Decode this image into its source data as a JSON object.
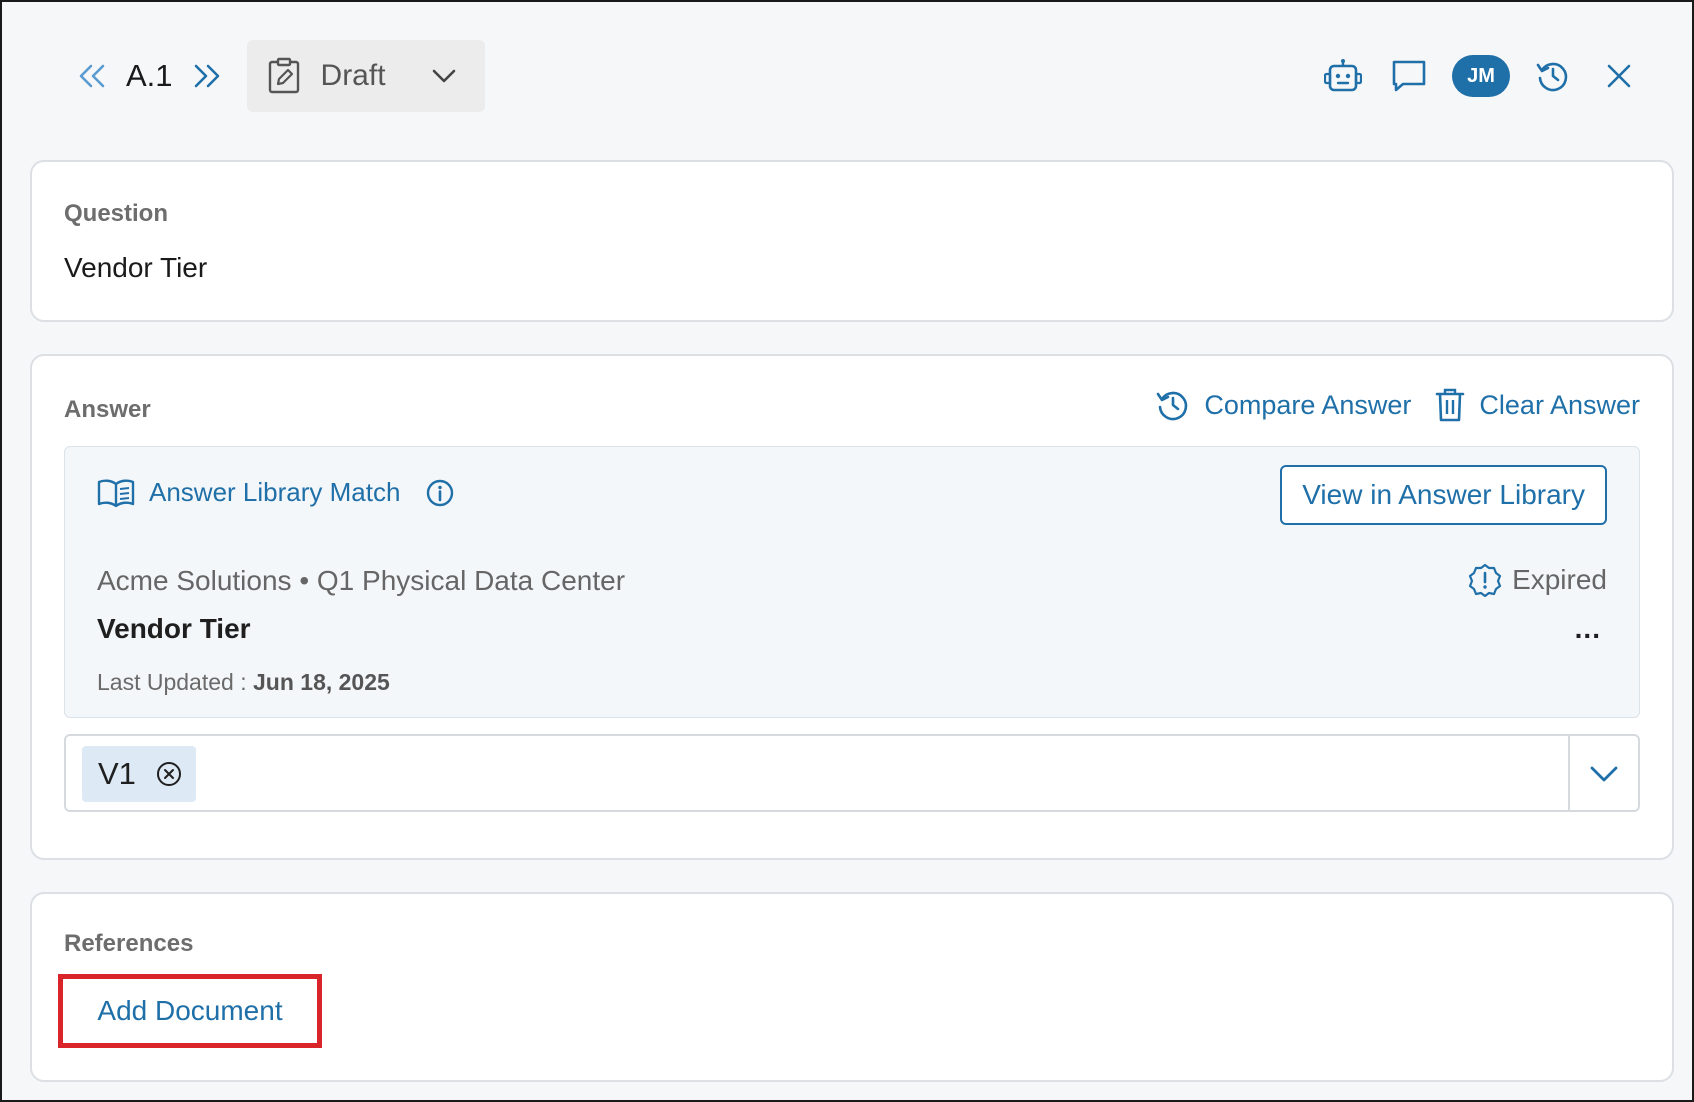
{
  "header": {
    "question_id": "A.1",
    "status": "Draft",
    "user_initials": "JM"
  },
  "question": {
    "label": "Question",
    "text": "Vendor Tier"
  },
  "answer": {
    "label": "Answer",
    "compare_label": "Compare Answer",
    "clear_label": "Clear Answer",
    "match": {
      "title": "Answer Library Match",
      "view_button": "View in Answer Library",
      "source": "Acme Solutions • Q1 Physical Data Center",
      "status": "Expired",
      "name": "Vendor Tier",
      "more": "...",
      "updated_label": "Last Updated : ",
      "updated_date": "Jun 18, 2025"
    },
    "version_chip": "V1"
  },
  "references": {
    "label": "References",
    "add_document": "Add Document"
  },
  "colors": {
    "accent": "#1f6fa8",
    "highlight_border": "#d9252a",
    "chip_bg": "#dde9f5"
  }
}
